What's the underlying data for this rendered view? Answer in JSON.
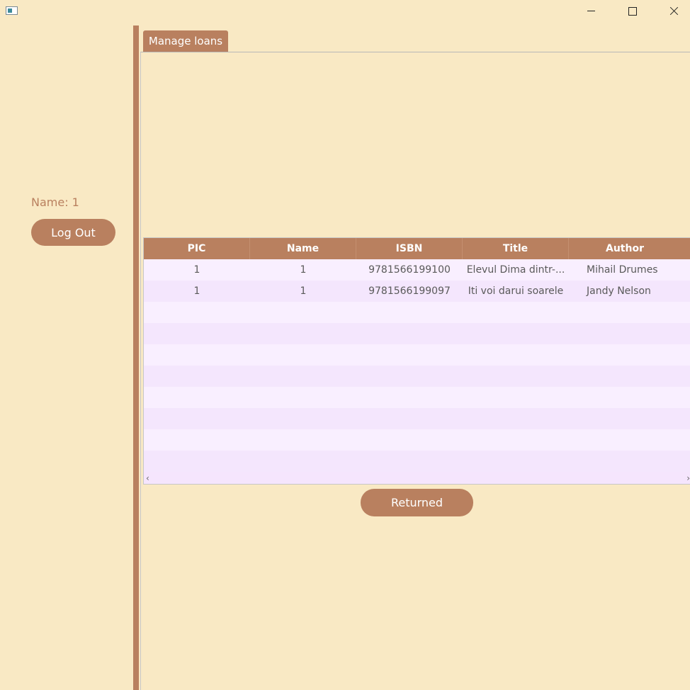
{
  "window": {
    "icons": {
      "app": "app-icon",
      "minimize": "minimize-icon",
      "maximize": "maximize-icon",
      "close": "close-icon"
    }
  },
  "sidebar": {
    "user_name": "Name: 1",
    "logout_label": "Log Out"
  },
  "tabs": [
    {
      "label": "Manage loans"
    }
  ],
  "loans_table": {
    "columns": [
      "PIC",
      "Name",
      "ISBN",
      "Title",
      "Author"
    ],
    "rows": [
      [
        "1",
        "1",
        "9781566199100",
        "Elevul Dima dintr-...",
        "Mihail Drumes"
      ],
      [
        "1",
        "1",
        "9781566199097",
        "Iti voi darui soarele",
        "Jandy Nelson"
      ]
    ],
    "scroll_left": "‹",
    "scroll_right": "›"
  },
  "actions": {
    "returned_label": "Returned"
  },
  "colors": {
    "background": "#f9e9c4",
    "accent": "#b9805f",
    "row_odd": "#f9efff",
    "row_even": "#f4e6fd",
    "text": "#5a5a5a"
  }
}
